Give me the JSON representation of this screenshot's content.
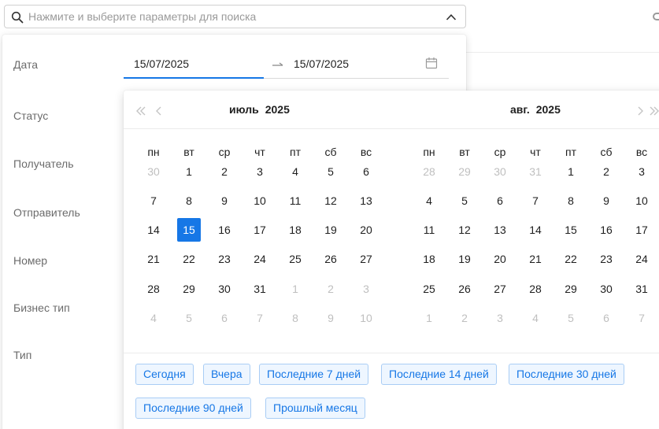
{
  "search": {
    "placeholder": "Нажмите и выберите параметры для поиска"
  },
  "filters": {
    "labels": [
      "Дата",
      "Статус",
      "Получатель",
      "Отправитель",
      "Номер",
      "Бизнес тип",
      "Тип"
    ]
  },
  "date_range": {
    "start": "15/07/2025",
    "end": "15/07/2025"
  },
  "calendar": {
    "left": {
      "month": "июль",
      "year": "2025",
      "weekdays": [
        "пн",
        "вт",
        "ср",
        "чт",
        "пт",
        "сб",
        "вс"
      ],
      "weeks": [
        [
          "30",
          "1",
          "2",
          "3",
          "4",
          "5",
          "6"
        ],
        [
          "7",
          "8",
          "9",
          "10",
          "11",
          "12",
          "13"
        ],
        [
          "14",
          "15",
          "16",
          "17",
          "18",
          "19",
          "20"
        ],
        [
          "21",
          "22",
          "23",
          "24",
          "25",
          "26",
          "27"
        ],
        [
          "28",
          "29",
          "30",
          "31",
          "1",
          "2",
          "3"
        ],
        [
          "4",
          "5",
          "6",
          "7",
          "8",
          "9",
          "10"
        ]
      ],
      "out_of_month": [
        [
          0,
          0
        ],
        [
          4,
          4
        ],
        [
          4,
          5
        ],
        [
          4,
          6
        ],
        [
          5,
          0
        ],
        [
          5,
          1
        ],
        [
          5,
          2
        ],
        [
          5,
          3
        ],
        [
          5,
          4
        ],
        [
          5,
          5
        ],
        [
          5,
          6
        ]
      ],
      "selected": [
        2,
        1
      ]
    },
    "right": {
      "month": "авг.",
      "year": "2025",
      "weekdays": [
        "пн",
        "вт",
        "ср",
        "чт",
        "пт",
        "сб",
        "вс"
      ],
      "weeks": [
        [
          "28",
          "29",
          "30",
          "31",
          "1",
          "2",
          "3"
        ],
        [
          "4",
          "5",
          "6",
          "7",
          "8",
          "9",
          "10"
        ],
        [
          "11",
          "12",
          "13",
          "14",
          "15",
          "16",
          "17"
        ],
        [
          "18",
          "19",
          "20",
          "21",
          "22",
          "23",
          "24"
        ],
        [
          "25",
          "26",
          "27",
          "28",
          "29",
          "30",
          "31"
        ],
        [
          "1",
          "2",
          "3",
          "4",
          "5",
          "6",
          "7"
        ]
      ],
      "out_of_month": [
        [
          0,
          0
        ],
        [
          0,
          1
        ],
        [
          0,
          2
        ],
        [
          0,
          3
        ],
        [
          5,
          0
        ],
        [
          5,
          1
        ],
        [
          5,
          2
        ],
        [
          5,
          3
        ],
        [
          5,
          4
        ],
        [
          5,
          5
        ],
        [
          5,
          6
        ]
      ]
    }
  },
  "presets": [
    "Сегодня",
    "Вчера",
    "Последние 7 дней",
    "Последние 14 дней",
    "Последние 30 дней",
    "Последние 90 дней",
    "Прошлый месяц"
  ],
  "colors": {
    "accent": "#1677e6",
    "preset_bg": "#eef6ff",
    "preset_border": "#a9cdf5",
    "muted_text": "#bfbfbf"
  },
  "icons": {
    "search": "search-icon",
    "collapse": "chevron-up-icon",
    "range_separator": "arrow-right-icon",
    "calendar": "calendar-icon",
    "prev_year": "double-chevron-left-icon",
    "prev_month": "chevron-left-icon",
    "next_month": "chevron-right-icon",
    "next_year": "double-chevron-right-icon"
  }
}
